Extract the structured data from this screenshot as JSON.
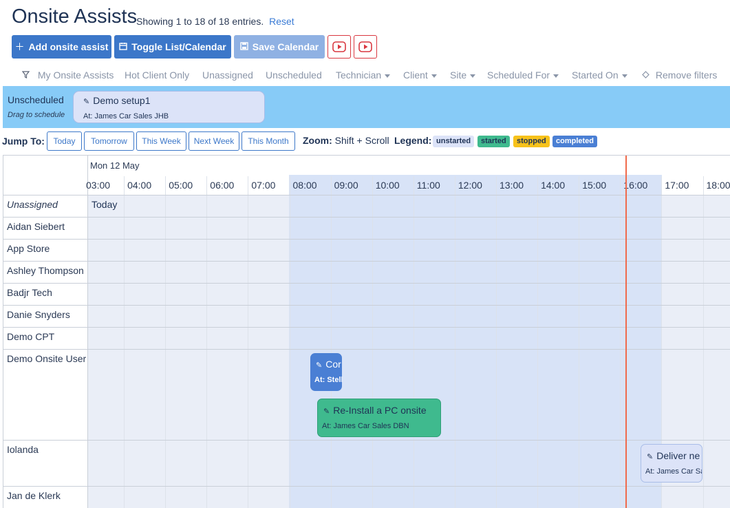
{
  "header": {
    "title": "Onsite Assists",
    "entries_text": "Showing 1 to 18 of 18 entries.",
    "reset_label": "Reset"
  },
  "toolbar": {
    "add_label": "Add onsite assist",
    "toggle_label": "Toggle List/Calendar",
    "save_label": "Save Calendar"
  },
  "filters": {
    "my_onsite": "My Onsite Assists",
    "hot_client": "Hot Client Only",
    "unassigned": "Unassigned",
    "unscheduled": "Unscheduled",
    "technician": "Technician",
    "client": "Client",
    "site": "Site",
    "scheduled_for": "Scheduled For",
    "started_on": "Started On",
    "remove": "Remove filters"
  },
  "unscheduled": {
    "title": "Unscheduled",
    "subtitle": "Drag to schedule",
    "card_title": "Demo setup1",
    "card_sub": "At: James Car Sales JHB"
  },
  "jump": {
    "label": "Jump To:",
    "today": "Today",
    "tomorrow": "Tomorrow",
    "this_week": "This Week",
    "next_week": "Next Week",
    "this_month": "This Month"
  },
  "zoom": {
    "label": "Zoom:",
    "text": "Shift + Scroll"
  },
  "legend": {
    "label": "Legend:",
    "unstarted": "unstarted",
    "started": "started",
    "stopped": "stopped",
    "completed": "completed"
  },
  "colors": {
    "primary": "#3c77c9",
    "unstarted": "#dce3f8",
    "started": "#3fba8e",
    "stopped": "#f7c21b",
    "completed": "#4a7fd4",
    "now_line": "#f06a4b",
    "band": "#87cbf7"
  },
  "calendar": {
    "date_label": "Mon 12 May",
    "today_label": "Today",
    "hours": [
      "03:00",
      "04:00",
      "05:00",
      "06:00",
      "07:00",
      "08:00",
      "09:00",
      "10:00",
      "11:00",
      "12:00",
      "13:00",
      "14:00",
      "15:00",
      "16:00",
      "17:00",
      "18:00"
    ],
    "resources": [
      "Unassigned",
      "Aidan Siebert",
      "App Store",
      "Ashley Thompson",
      "Badjr Tech",
      "Danie Snyders",
      "Demo CPT",
      "Demo Onsite User",
      "Iolanda",
      "Jan de Klerk"
    ]
  },
  "events": {
    "e1": {
      "title": "Cor",
      "sub": "At: Stelle",
      "status": "completed"
    },
    "e2": {
      "title": "Re-Install a PC onsite",
      "sub": "At: James Car Sales DBN",
      "status": "started"
    },
    "e3": {
      "title": "Deliver ne",
      "sub": "At: James Car Sa",
      "status": "unstarted"
    }
  }
}
